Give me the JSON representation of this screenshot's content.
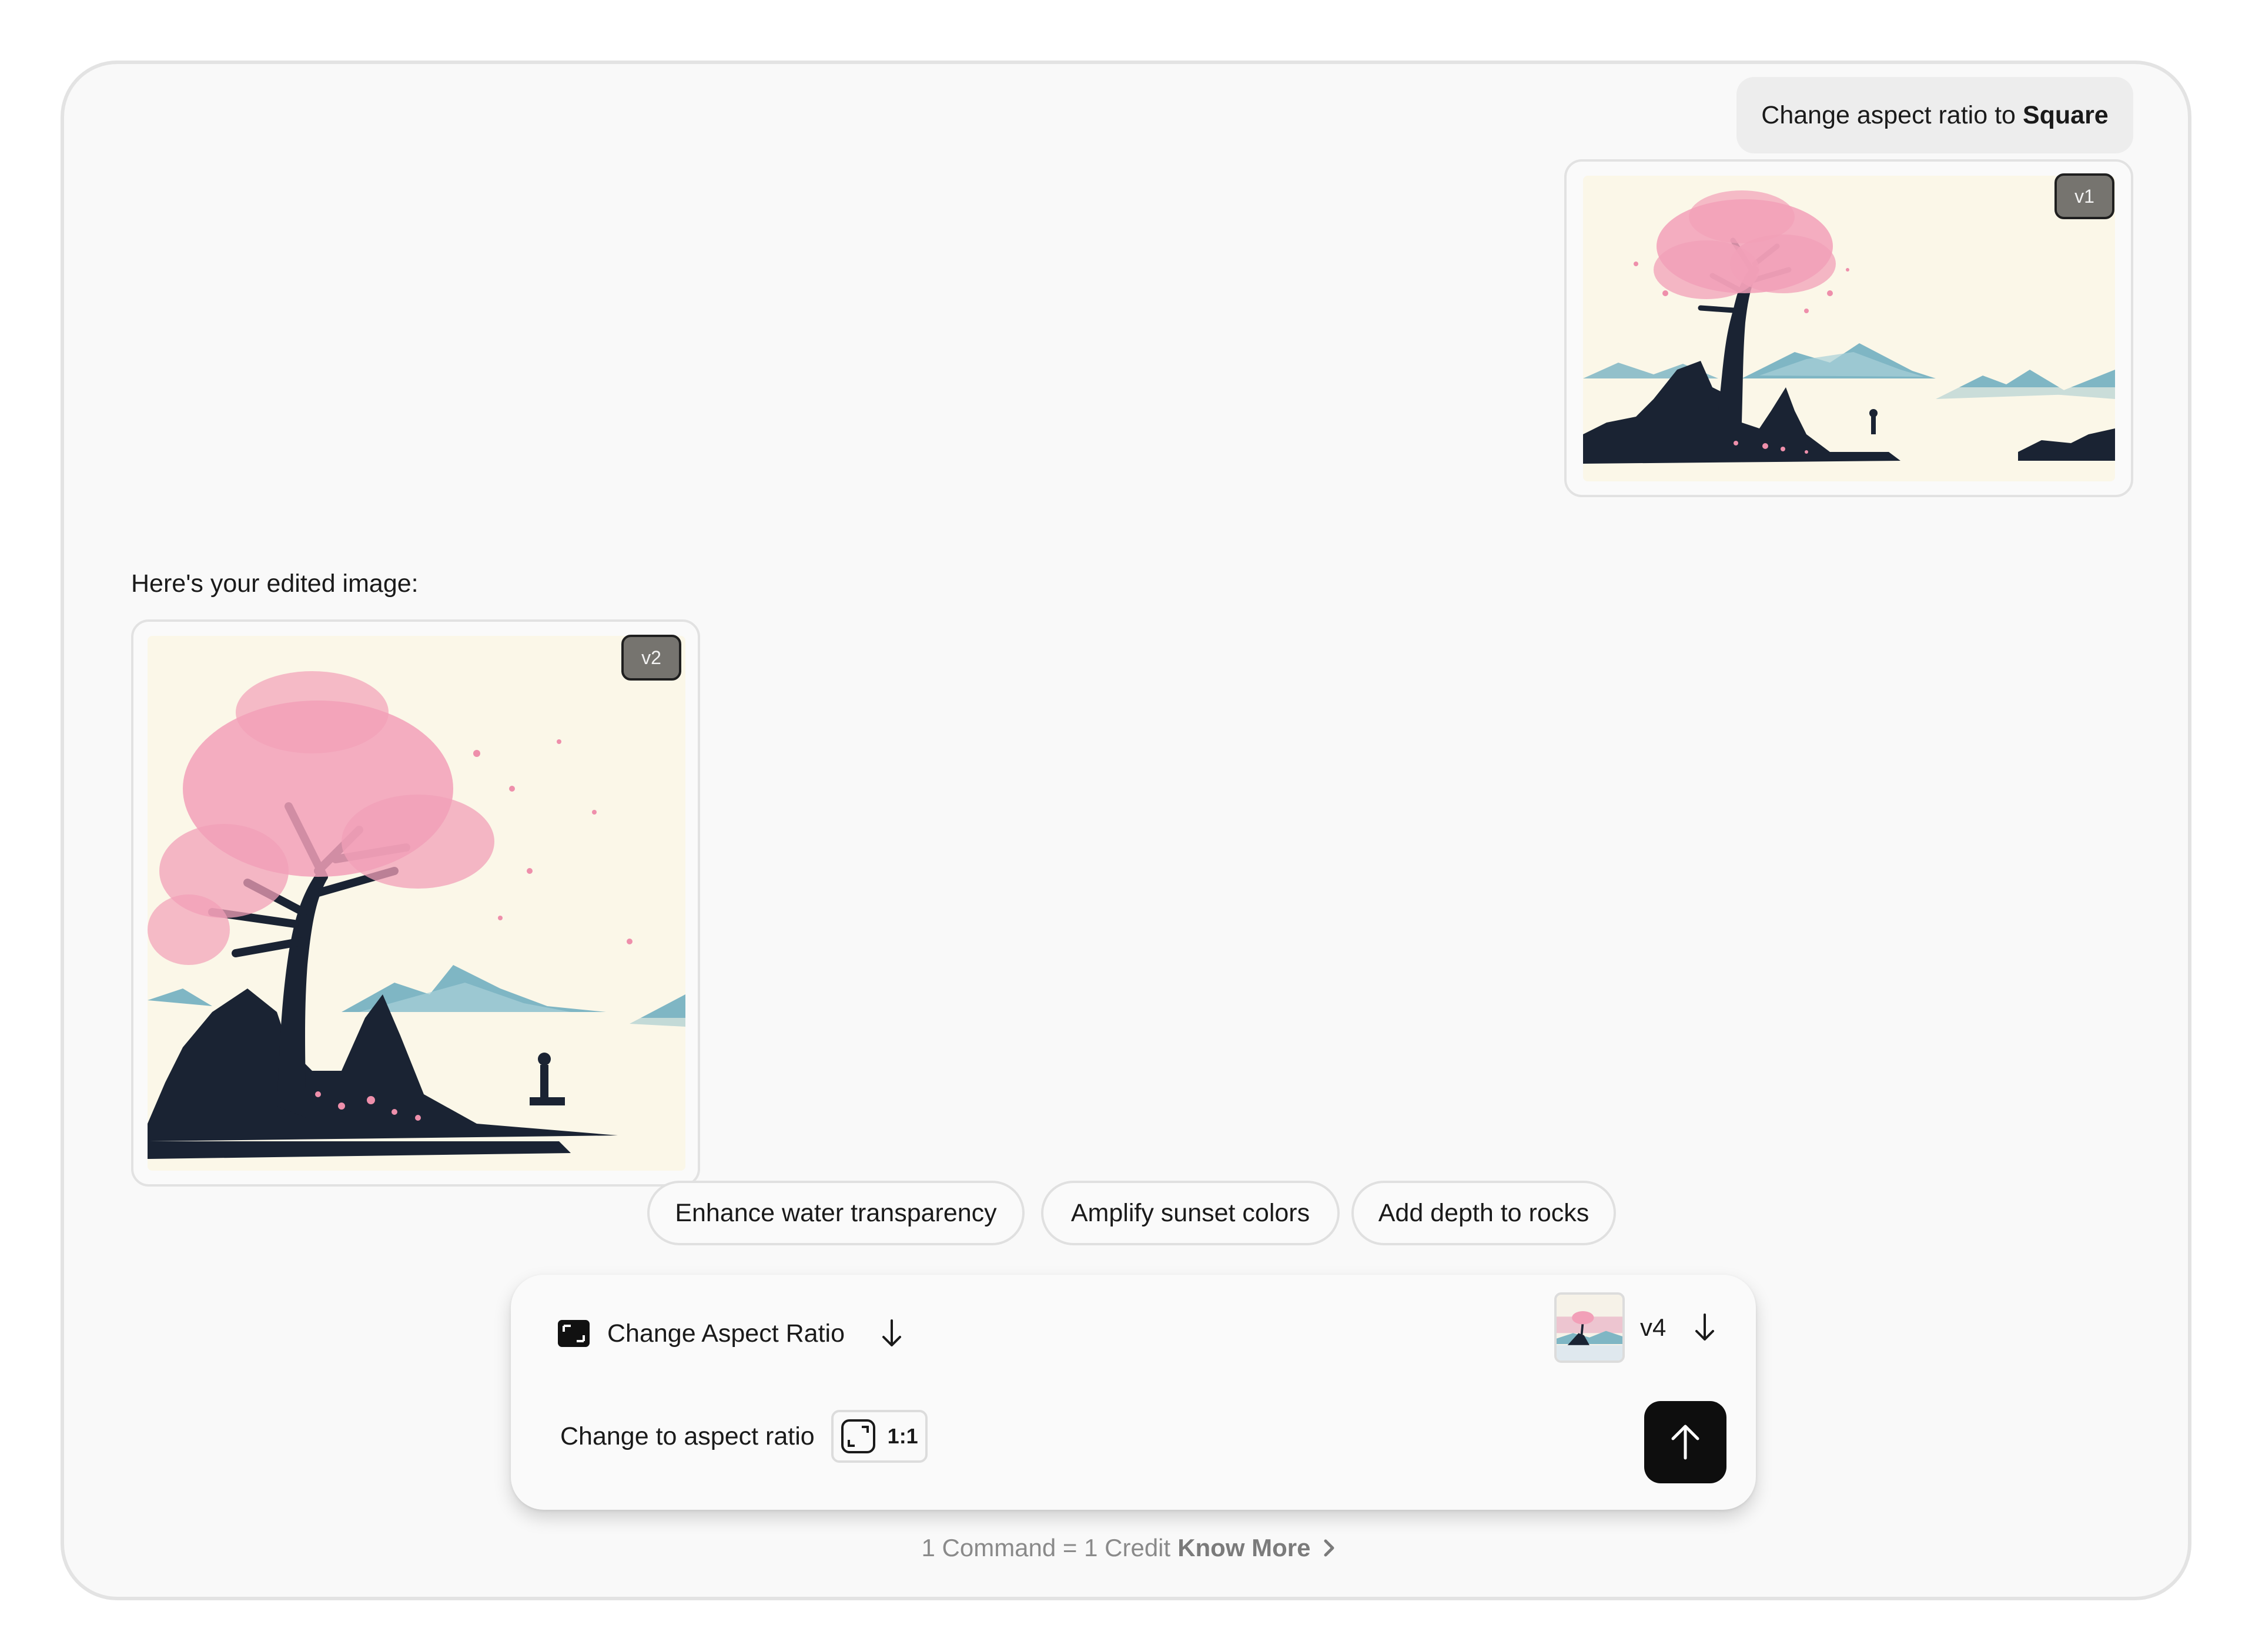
{
  "conversation": {
    "user_message_prefix": "Change aspect ratio to",
    "user_message_bold": "Square",
    "user_image_version": "v1",
    "assistant_text": "Here's your edited image:",
    "assistant_image_version": "v2"
  },
  "suggestions": [
    "Enhance water transparency",
    "Amplify sunset colors",
    "Add depth to rocks"
  ],
  "composer": {
    "tool_label": "Change Aspect Ratio",
    "tool_icon": "aspect-ratio-icon",
    "version_label": "v4",
    "prompt_text": "Change to aspect ratio",
    "ratio_value": "1:1",
    "send_icon": "arrow-up-icon"
  },
  "footer": {
    "credit_text": "1 Command = 1 Credit",
    "know_more": "Know More"
  },
  "colors": {
    "frame_bg": "#f9f9f9",
    "badge_bg": "#76746f",
    "send_bg": "#0e0e0e",
    "blossom": "#f2a0b8",
    "mountain": "#7fb6c4",
    "ink": "#1a2333",
    "paper": "#fbf7e8"
  }
}
